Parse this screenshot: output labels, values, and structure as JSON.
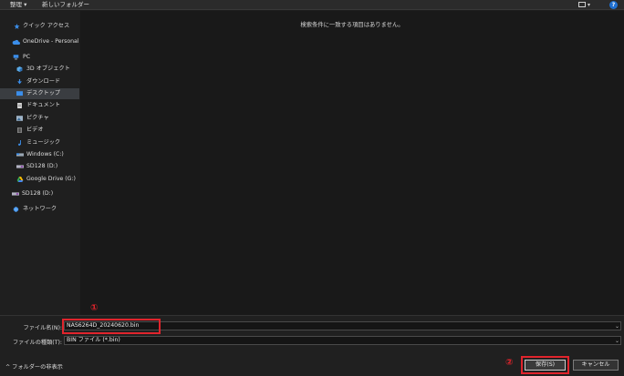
{
  "toolbar": {
    "organize_label": "整理 ▾",
    "new_folder_label": "新しいフォルダー",
    "view_chevron": "▾",
    "help_label": "?"
  },
  "sidebar": {
    "quick_access": "クイック アクセス",
    "onedrive": "OneDrive - Personal",
    "pc": "PC",
    "objects3d": "3D オブジェクト",
    "downloads": "ダウンロード",
    "desktop": "デスクトップ",
    "documents": "ドキュメント",
    "pictures": "ピクチャ",
    "videos": "ビデオ",
    "music": "ミュージック",
    "windows_c": "Windows (C:)",
    "sd128_d": "SD128 (D:)",
    "google_drive": "Google Drive (G:)",
    "sd128_d_root": "SD128 (D:)",
    "network": "ネットワーク"
  },
  "main": {
    "empty_message": "検索条件に一致する項目はありません。"
  },
  "bottom": {
    "filename_label": "ファイル名(N):",
    "filename_value": "NAS6264D_20240620.bin",
    "filetype_label": "ファイルの種類(T):",
    "filetype_value": "BIN ファイル (*.bin)",
    "hide_folders": "^ フォルダーの非表示",
    "save_label": "保存(S)",
    "cancel_label": "キャンセル"
  },
  "annotations": {
    "mark1": "①",
    "mark2": "②"
  },
  "colors": {
    "accent_highlight": "#e0242c",
    "selection": "#3a3d41",
    "background": "#1e1e1e"
  }
}
